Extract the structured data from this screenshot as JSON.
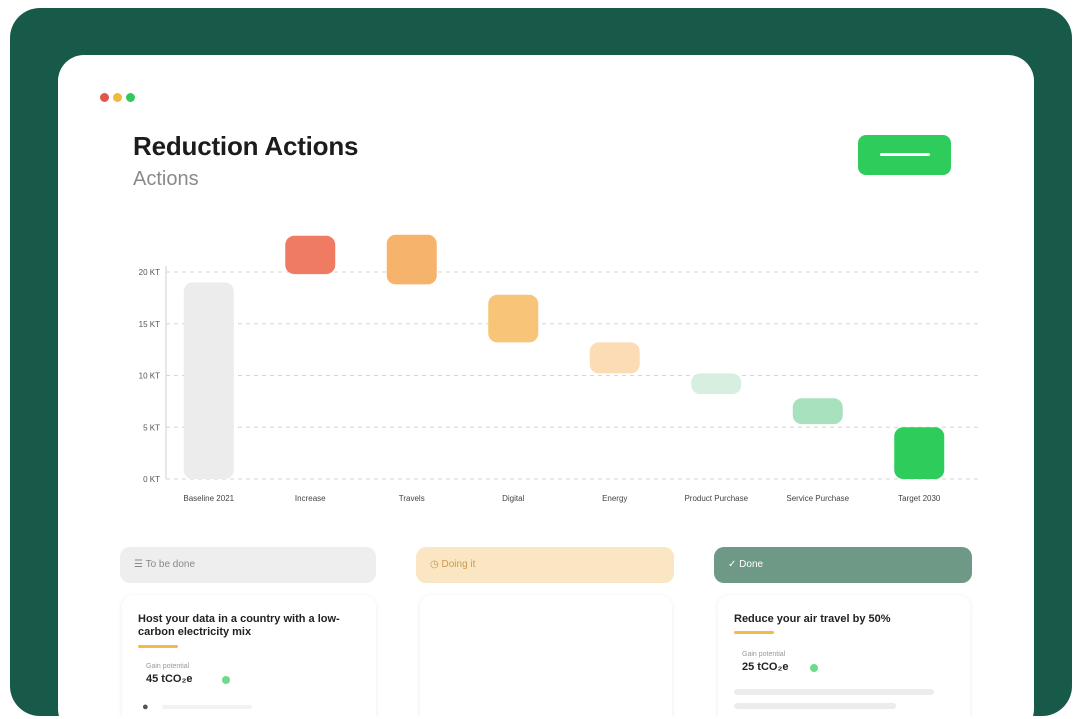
{
  "window": {
    "title": "Reduction Actions",
    "subtitle": "Actions",
    "traffic_lights": [
      "#e0574b",
      "#f0b93e",
      "#34c759"
    ],
    "primary_button_color": "#2ecc5a"
  },
  "chart_data": {
    "type": "bar",
    "subtype": "waterfall",
    "categories": [
      "Baseline 2021",
      "Increase",
      "Travels",
      "Digital",
      "Energy",
      "Product Purchase",
      "Service Purchase",
      "Target 2030"
    ],
    "y_ticks": [
      "0 KT",
      "5 KT",
      "10 KT",
      "15 KT",
      "20 KT"
    ],
    "ylim": [
      0,
      24
    ],
    "grid": true,
    "bars": [
      {
        "category": "Baseline 2021",
        "low": 0,
        "high": 19.0,
        "color": "#ececec"
      },
      {
        "category": "Increase",
        "low": 19.8,
        "high": 23.5,
        "color": "#ef7b63"
      },
      {
        "category": "Travels",
        "low": 18.8,
        "high": 23.6,
        "color": "#f6b36b"
      },
      {
        "category": "Digital",
        "low": 13.2,
        "high": 17.8,
        "color": "#f8c478"
      },
      {
        "category": "Energy",
        "low": 10.2,
        "high": 13.2,
        "color": "#fbdcb4"
      },
      {
        "category": "Product Purchase",
        "low": 8.2,
        "high": 10.2,
        "color": "#d6efe0"
      },
      {
        "category": "Service Purchase",
        "low": 5.3,
        "high": 7.8,
        "color": "#a8e1bd"
      },
      {
        "category": "Target 2030",
        "low": 0,
        "high": 5.0,
        "color": "#2ecc5a"
      }
    ]
  },
  "columns": [
    {
      "label": "To be done",
      "bg": "#eeeeee",
      "color": "#888888"
    },
    {
      "label": "Doing it",
      "bg": "#fbe6c4",
      "color": "#c99a4e"
    },
    {
      "label": "Done",
      "bg": "#6f9987",
      "color": "#ffffff"
    }
  ],
  "cards": [
    {
      "title": "Host your data in a country with a low-carbon electricity mix",
      "amount_label": "Gain potential",
      "amount": "45 tCO₂e"
    },
    {
      "title": "Reduce your air travel by 50%",
      "amount_label": "Gain potential",
      "amount": "25 tCO₂e"
    }
  ]
}
